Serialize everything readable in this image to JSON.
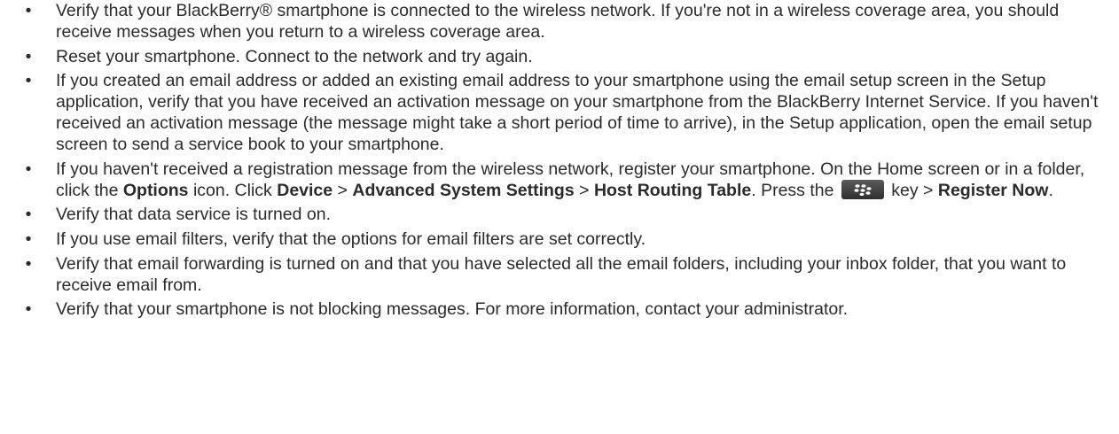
{
  "items": [
    {
      "text": "Verify that your BlackBerry® smartphone is connected to the wireless network. If you're not in a wireless coverage area, you should receive messages when you return to a wireless coverage area."
    },
    {
      "text": "Reset your smartphone. Connect to the network and try again."
    },
    {
      "text": "If you created an email address or added an existing email address to your smartphone using the email setup screen in the Setup application, verify that you have received an activation message on your smartphone from the BlackBerry Internet Service. If you haven't received an activation message (the message might take a short period of time to arrive), in the Setup application, open the email setup screen to send a service book to your smartphone."
    },
    {
      "t1": "If you haven't received a registration message from the wireless network, register your smartphone. On the Home screen or in a folder, click the ",
      "b1": "Options",
      "t2": " icon. Click ",
      "b2": "Device",
      "t3": " > ",
      "b3": "Advanced System Settings",
      "t4": " > ",
      "b4": "Host Routing Table",
      "t5": ". Press the ",
      "key_icon": "blackberry-menu-key-icon",
      "t6": " key > ",
      "b5": "Register Now",
      "t7": "."
    },
    {
      "text": "Verify that data service is turned on."
    },
    {
      "text": "If you use email filters, verify that the options for email filters are set correctly."
    },
    {
      "text": "Verify that email forwarding is turned on and that you have selected all the email folders, including your inbox folder, that you want to receive email from."
    },
    {
      "text": "Verify that your smartphone is not blocking messages. For more information, contact your administrator."
    }
  ],
  "bullet": "•"
}
